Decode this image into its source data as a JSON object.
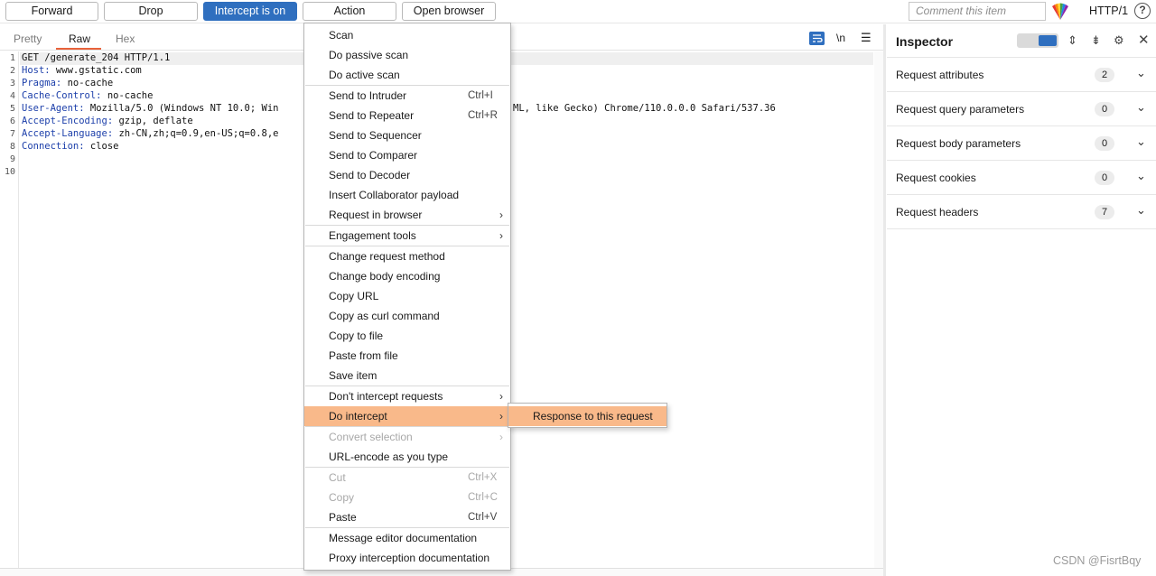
{
  "toolbar": {
    "forward": "Forward",
    "drop": "Drop",
    "intercept": "Intercept is on",
    "action": "Action",
    "open_browser": "Open browser",
    "comment_placeholder": "Comment this item",
    "http_version": "HTTP/1",
    "help": "?"
  },
  "editor": {
    "tabs": [
      "Pretty",
      "Raw",
      "Hex"
    ],
    "active_tab": "Raw",
    "newline_toggle": "\\n",
    "line_numbers": [
      "1",
      "2",
      "3",
      "4",
      "5",
      "6",
      "7",
      "8",
      "9",
      "10"
    ],
    "lines": [
      {
        "key": "",
        "val": "GET /generate_204 HTTP/1.1"
      },
      {
        "key": "Host:",
        "val": " www.gstatic.com"
      },
      {
        "key": "Pragma:",
        "val": " no-cache"
      },
      {
        "key": "Cache-Control:",
        "val": " no-cache"
      },
      {
        "key": "User-Agent:",
        "val": " Mozilla/5.0 (Windows NT 10.0; Win"
      },
      {
        "key": "Accept-Encoding:",
        "val": " gzip, deflate"
      },
      {
        "key": "Accept-Language:",
        "val": " zh-CN,zh;q=0.9,en-US;q=0.8,e"
      },
      {
        "key": "Connection:",
        "val": " close"
      }
    ],
    "line5_tail": "ML, like Gecko) Chrome/110.0.0.0 Safari/537.36"
  },
  "inspector": {
    "title": "Inspector",
    "rows": [
      {
        "label": "Request attributes",
        "count": "2"
      },
      {
        "label": "Request query parameters",
        "count": "0"
      },
      {
        "label": "Request body parameters",
        "count": "0"
      },
      {
        "label": "Request cookies",
        "count": "0"
      },
      {
        "label": "Request headers",
        "count": "7"
      }
    ]
  },
  "context_menu": {
    "items": [
      {
        "label": "Scan"
      },
      {
        "label": "Do passive scan"
      },
      {
        "label": "Do active scan"
      },
      {
        "label": "Send to Intruder",
        "shortcut": "Ctrl+I"
      },
      {
        "label": "Send to Repeater",
        "shortcut": "Ctrl+R"
      },
      {
        "label": "Send to Sequencer"
      },
      {
        "label": "Send to Comparer"
      },
      {
        "label": "Send to Decoder"
      },
      {
        "label": "Insert Collaborator payload"
      },
      {
        "label": "Request in browser",
        "submenu": true
      },
      {
        "label": "Engagement tools",
        "submenu": true
      },
      {
        "label": "Change request method"
      },
      {
        "label": "Change body encoding"
      },
      {
        "label": "Copy URL"
      },
      {
        "label": "Copy as curl command"
      },
      {
        "label": "Copy to file"
      },
      {
        "label": "Paste from file"
      },
      {
        "label": "Save item"
      },
      {
        "label": "Don't intercept requests",
        "submenu": true
      },
      {
        "label": "Do intercept",
        "submenu": true,
        "highlighted": true
      },
      {
        "label": "Convert selection",
        "submenu": true,
        "disabled": true
      },
      {
        "label": "URL-encode as you type"
      },
      {
        "label": "Cut",
        "shortcut": "Ctrl+X",
        "disabled": true
      },
      {
        "label": "Copy",
        "shortcut": "Ctrl+C",
        "disabled": true
      },
      {
        "label": "Paste",
        "shortcut": "Ctrl+V"
      },
      {
        "label": "Message editor documentation"
      },
      {
        "label": "Proxy interception documentation"
      }
    ],
    "submenu_label": "Response to this request"
  },
  "watermark": "CSDN @FisrtBqy",
  "colors": {
    "accent_blue": "#2f6fbf",
    "tab_underline": "#e8623a",
    "menu_highlight": "#f9b98a",
    "header_key": "#1c3faa"
  }
}
